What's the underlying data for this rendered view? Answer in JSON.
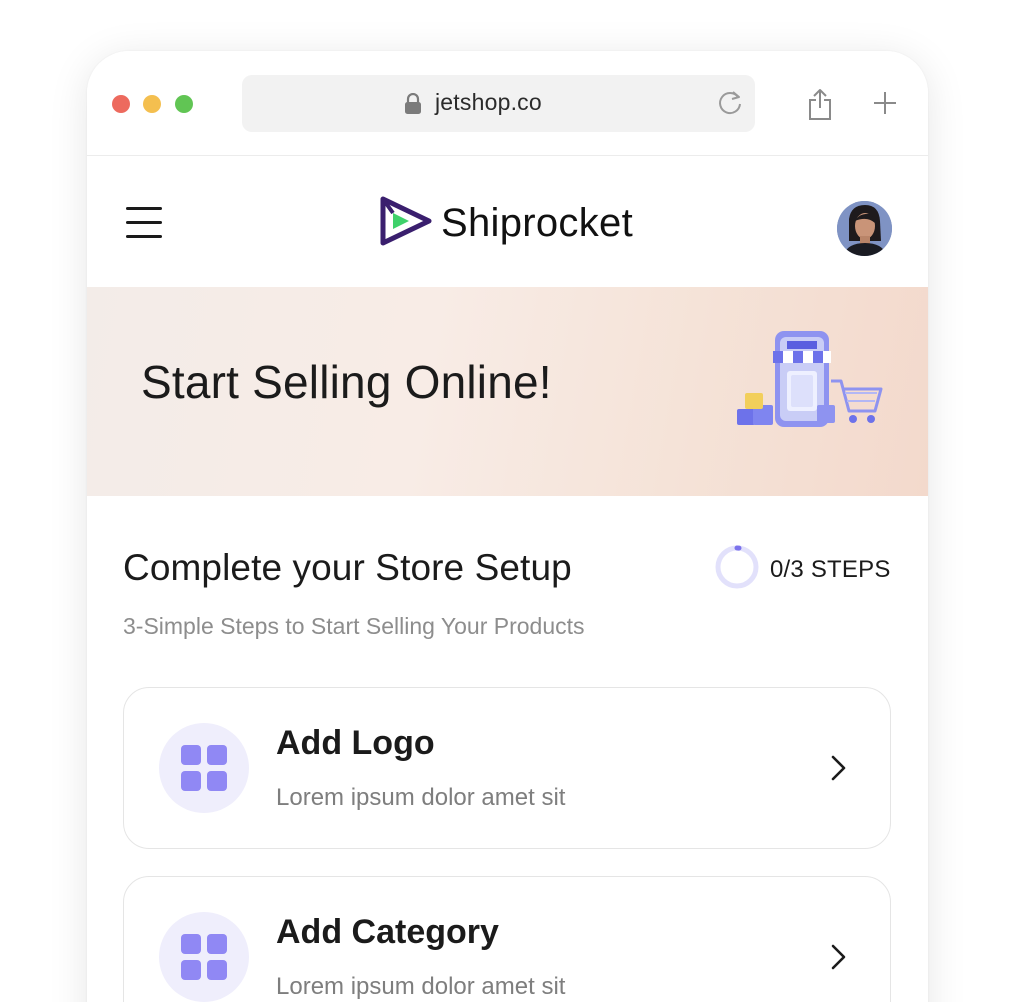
{
  "browser": {
    "url": "jetshop.co",
    "traffic_lights": {
      "close": "#ed6a5e",
      "minimize": "#f4bf4f",
      "zoom": "#61c554"
    }
  },
  "header": {
    "brand_name": "Shiprocket",
    "menu_icon": "hamburger-icon",
    "avatar_icon": "user-avatar"
  },
  "banner": {
    "title": "Start Selling Online!"
  },
  "setup": {
    "title": "Complete your Store Setup",
    "steps_label": "0/3 STEPS",
    "steps_completed": 0,
    "steps_total": 3,
    "subtitle": "3-Simple Steps to Start Selling Your Products"
  },
  "tasks": [
    {
      "title": "Add Logo",
      "description": "Lorem ipsum dolor amet sit",
      "icon": "grid-icon"
    },
    {
      "title": "Add Category",
      "description": "Lorem ipsum dolor amet sit",
      "icon": "grid-icon"
    }
  ],
  "colors": {
    "accent": "#9088f4",
    "accent_light": "#efeefc",
    "brand_purple": "#3a1f6e",
    "brand_green": "#3fd16b",
    "text": "#1b1b1b",
    "muted": "#8d8d8d"
  }
}
